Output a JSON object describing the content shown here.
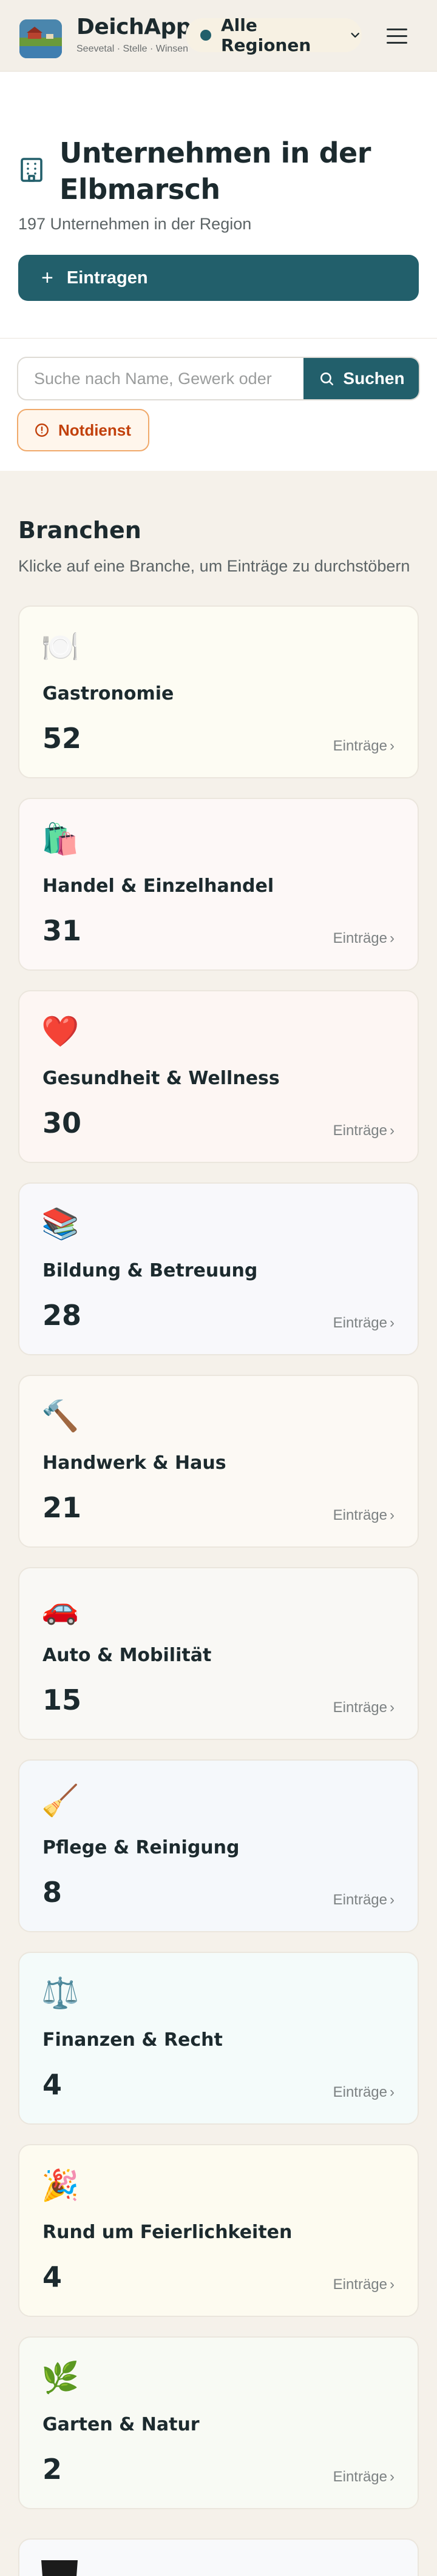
{
  "header": {
    "app_name": "DeichApp",
    "tagline": "Seevetal · Stelle · Winsen",
    "region_selector": "Alle Regionen"
  },
  "hero": {
    "title": "Unternehmen in der Elbmarsch",
    "count_text": "197 Unternehmen in der Region",
    "add_button": "Eintragen"
  },
  "search": {
    "placeholder": "Suche nach Name, Gewerk oder",
    "button": "Suchen",
    "filter_notdienst": "Notdienst"
  },
  "branches": {
    "title": "Branchen",
    "subtitle": "Klicke auf eine Branche, um Einträge zu durchstöbern",
    "entries_label": "Einträge",
    "items": [
      {
        "icon": "🍽️",
        "icon_name": "plate-cutlery-icon",
        "name": "Gastronomie",
        "count": "52",
        "bg": "#fdfcf3"
      },
      {
        "icon": "🛍️",
        "icon_name": "shopping-bags-icon",
        "name": "Handel & Einzelhandel",
        "count": "31",
        "bg": "#fdf8f7"
      },
      {
        "icon": "❤️",
        "icon_name": "heart-icon",
        "name": "Gesundheit & Wellness",
        "count": "30",
        "bg": "#fdf6f3"
      },
      {
        "icon": "📚",
        "icon_name": "books-icon",
        "name": "Bildung & Betreuung",
        "count": "28",
        "bg": "#f8f8fb"
      },
      {
        "icon": "🔨",
        "icon_name": "hammer-icon",
        "name": "Handwerk & Haus",
        "count": "21",
        "bg": "#fcf9f4"
      },
      {
        "icon": "🚗",
        "icon_name": "car-icon",
        "name": "Auto & Mobilität",
        "count": "15",
        "bg": "#f9f8f5"
      },
      {
        "icon": "🧹",
        "icon_name": "broom-icon",
        "name": "Pflege & Reinigung",
        "count": "8",
        "bg": "#f5f8fb"
      },
      {
        "icon": "⚖️",
        "icon_name": "scales-icon",
        "name": "Finanzen & Recht",
        "count": "4",
        "bg": "#f4fbfa"
      },
      {
        "icon": "🎉",
        "icon_name": "party-popper-icon",
        "name": "Rund um Feierlichkeiten",
        "count": "4",
        "bg": "#fdfbf0"
      },
      {
        "icon": "🌿",
        "icon_name": "herb-icon",
        "name": "Garten & Natur",
        "count": "2",
        "bg": "#f8faf4"
      }
    ]
  },
  "colors": {
    "primary": "#225f6b",
    "page_bg": "#f5f1ea",
    "notdienst": "#c2410c"
  }
}
